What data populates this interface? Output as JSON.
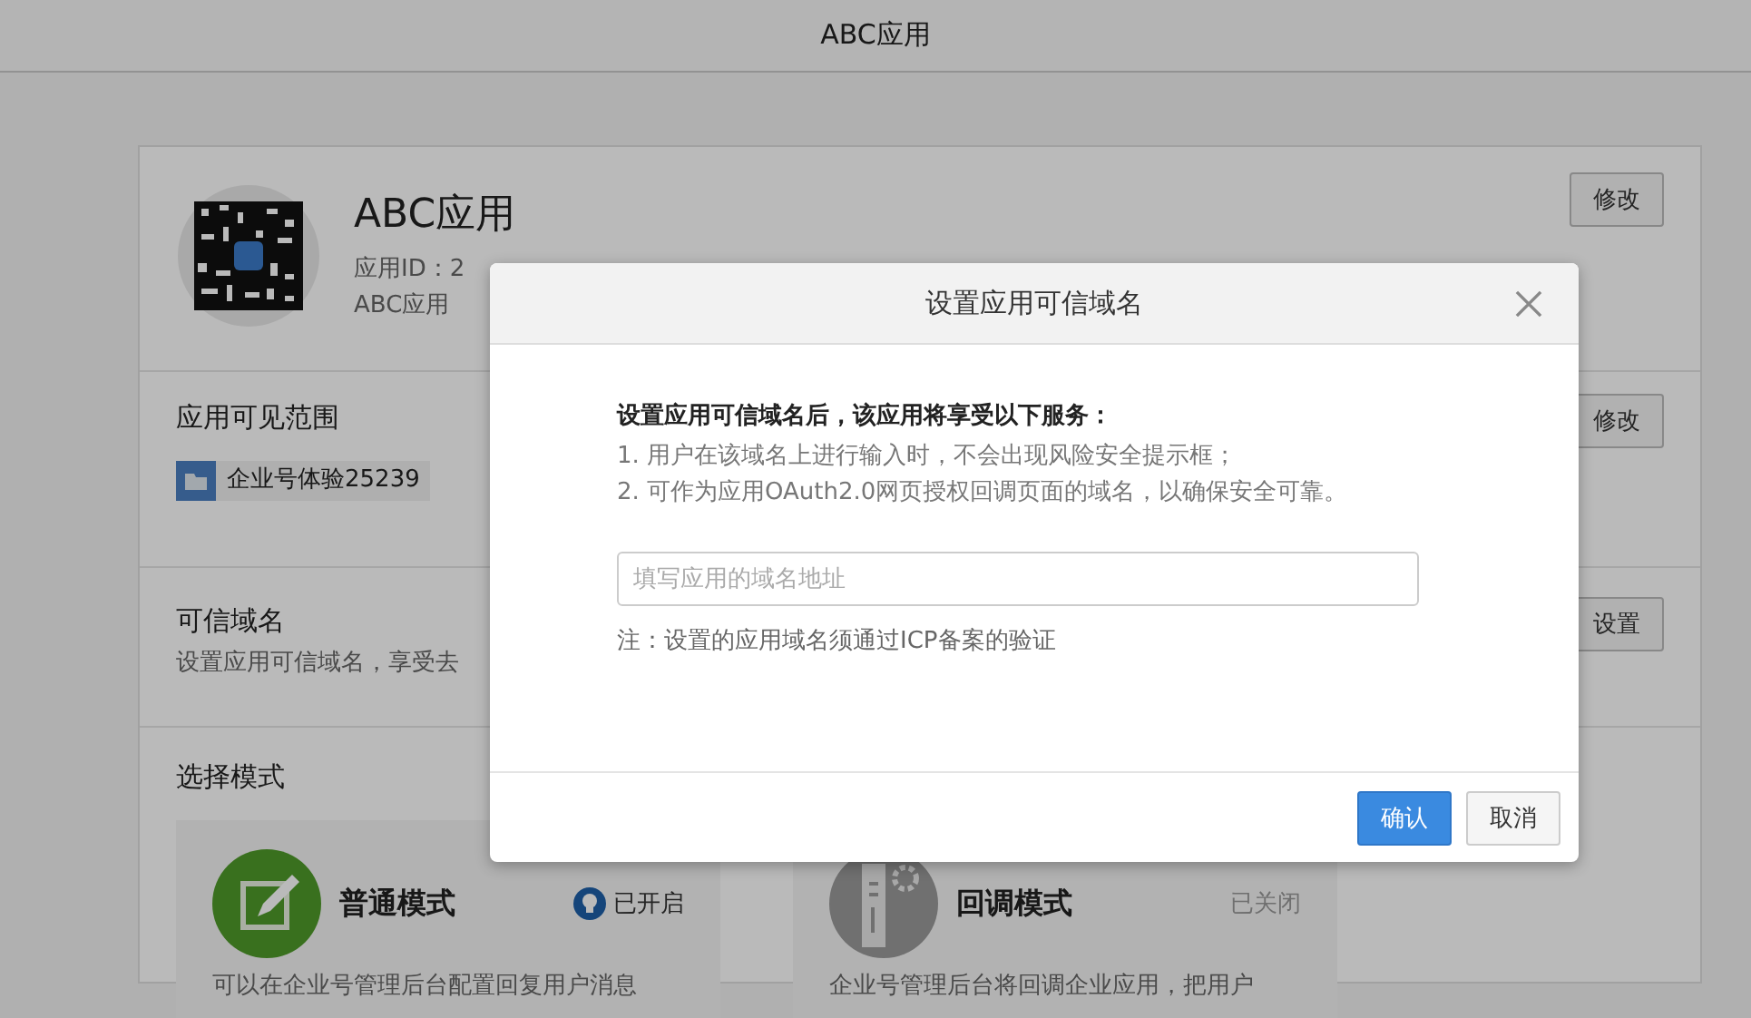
{
  "header": {
    "title": "ABC应用"
  },
  "app": {
    "name": "ABC应用",
    "id_label": "应用ID：2",
    "description": "ABC应用",
    "edit_button": "修改"
  },
  "visibility": {
    "title": "应用可见范围",
    "edit_button": "修改",
    "tag": "企业号体验25239"
  },
  "trusted_domain": {
    "title": "可信域名",
    "description": "设置应用可信域名，享受去",
    "set_button": "设置"
  },
  "modes": {
    "title": "选择模式",
    "items": [
      {
        "kind": "normal",
        "name": "普通模式",
        "status": "已开启",
        "enabled": true,
        "description": "可以在企业号管理后台配置回复用户消息"
      },
      {
        "kind": "callback",
        "name": "回调模式",
        "status": "已关闭",
        "enabled": false,
        "description": "企业号管理后台将回调企业应用，把用户"
      }
    ]
  },
  "dialog": {
    "title": "设置应用可信域名",
    "intro": "设置应用可信域名后，该应用将享受以下服务：",
    "points": [
      "1. 用户在该域名上进行输入时，不会出现风险安全提示框；",
      "2. 可作为应用OAuth2.0网页授权回调页面的域名，以确保安全可靠。"
    ],
    "placeholder": "填写应用的域名地址",
    "note": "注：设置的应用域名须通过ICP备案的验证",
    "confirm": "确认",
    "cancel": "取消"
  }
}
